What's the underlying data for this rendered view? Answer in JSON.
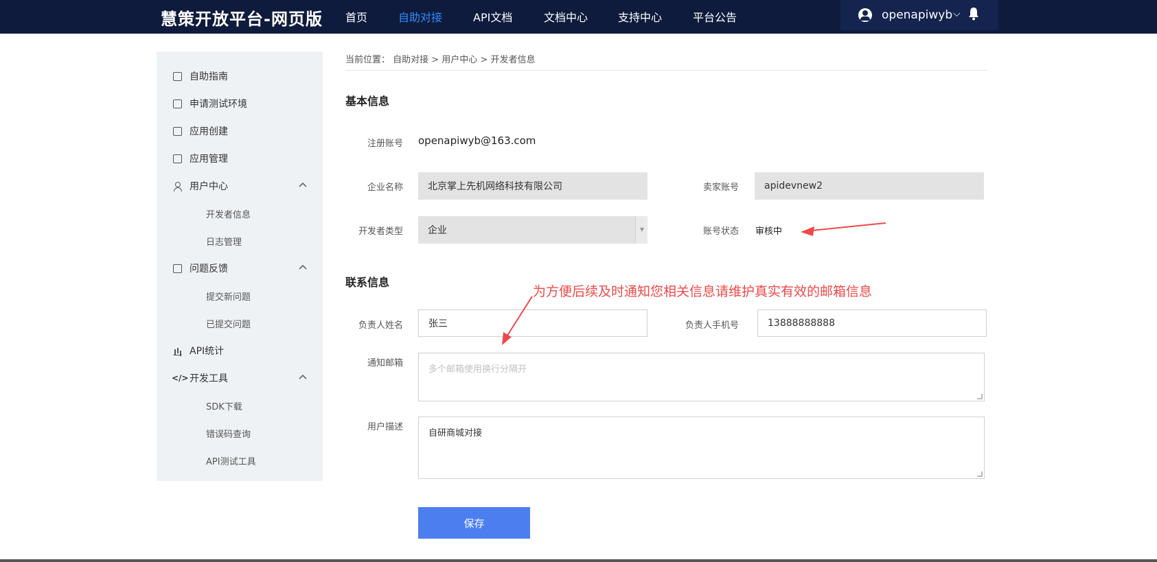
{
  "header": {
    "brand": "慧策开放平台-网页版",
    "nav": [
      "首页",
      "自助对接",
      "API文档",
      "文档中心",
      "支持中心",
      "平台公告"
    ],
    "active_nav": "自助对接",
    "username": "openapiwyb",
    "caret": "⌵"
  },
  "sidebar": {
    "items": [
      {
        "label": "自助指南",
        "icon": "guide-icon"
      },
      {
        "label": "申请测试环境",
        "icon": "monitor-icon"
      },
      {
        "label": "应用创建",
        "icon": "app-create-icon"
      },
      {
        "label": "应用管理",
        "icon": "app-manage-icon"
      },
      {
        "label": "用户中心",
        "icon": "user-icon",
        "expanded": true
      },
      {
        "label": "开发者信息",
        "sub": true
      },
      {
        "label": "日志管理",
        "sub": true
      },
      {
        "label": "问题反馈",
        "icon": "feedback-icon",
        "expanded": true
      },
      {
        "label": "提交新问题",
        "sub": true
      },
      {
        "label": "已提交问题",
        "sub": true
      },
      {
        "label": "API统计",
        "icon": "chart-icon"
      },
      {
        "label": "开发工具",
        "icon": "code-icon",
        "expanded": true
      },
      {
        "label": "SDK下载",
        "sub": true
      },
      {
        "label": "错误码查询",
        "sub": true
      },
      {
        "label": "API测试工具",
        "sub": true
      }
    ],
    "code_glyph": "</>"
  },
  "breadcrumb": "当前位置： 自助对接 > 用户中心 > 开发者信息",
  "basic": {
    "title": "基本信息",
    "account_label": "注册账号",
    "account_value": "openapiwyb@163.com",
    "company_label": "企业名称",
    "company_value": "北京掌上先机网络科技有限公司",
    "seller_label": "卖家账号",
    "seller_value": "apidevnew2",
    "devtype_label": "开发者类型",
    "devtype_value": "企业",
    "status_label": "账号状态",
    "status_value": "审核中"
  },
  "contact": {
    "title": "联系信息",
    "name_label": "负责人姓名",
    "name_value": "张三",
    "phone_label": "负责人手机号",
    "phone_value": "13888888888",
    "email_label": "通知邮箱",
    "email_placeholder": "多个邮箱使用换行分隔开",
    "desc_label": "用户描述",
    "desc_value": "自研商城对接"
  },
  "save_label": "保存",
  "annotation": "为方便后续及时通知您相关信息请维护真实有效的邮箱信息",
  "colors": {
    "topbar": "#0f1b3d",
    "active_nav": "#2f8cff",
    "button": "#4c7ef0",
    "annotation": "#f04848"
  }
}
